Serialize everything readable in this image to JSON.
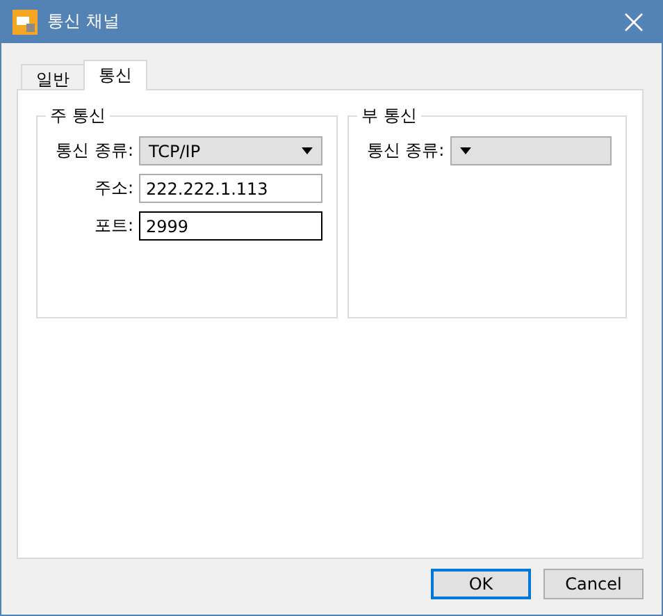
{
  "window": {
    "title": "통신 채널"
  },
  "tabs": [
    {
      "label": "일반",
      "selected": false
    },
    {
      "label": "통신",
      "selected": true
    }
  ],
  "groups": [
    {
      "title": "주 통신",
      "fields": [
        {
          "kind": "dropdown",
          "label": "통신 종류:",
          "value": "TCP/IP"
        },
        {
          "kind": "text",
          "label": "주소:",
          "value": "222.222.1.113",
          "focused": false
        },
        {
          "kind": "text",
          "label": "포트:",
          "value": "2999",
          "focused": true
        }
      ]
    },
    {
      "title": "부 통신",
      "fields": [
        {
          "kind": "dropdown",
          "label": "통신 종류:"
        }
      ]
    }
  ],
  "buttons": [
    {
      "label": "OK",
      "default": true
    },
    {
      "label": "Cancel",
      "default": false
    }
  ]
}
